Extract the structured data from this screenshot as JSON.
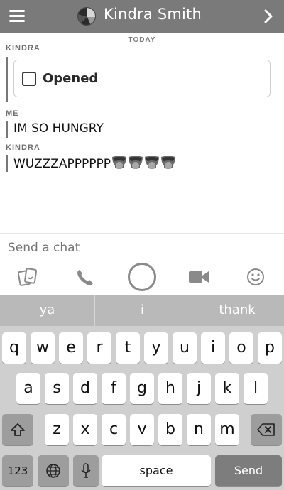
{
  "header": {
    "title": "Kindra Smith"
  },
  "chat": {
    "day_label": "TODAY",
    "messages": [
      {
        "sender": "KINDRA",
        "text": "Opened"
      },
      {
        "sender": "ME",
        "text": "IM SO HUNGRY"
      },
      {
        "sender": "KINDRA",
        "text": "WUZZZAPPPPPP"
      }
    ]
  },
  "compose": {
    "placeholder": "Send a chat"
  },
  "actions": [
    "sticker-icon",
    "phone-icon",
    "capture-button",
    "video-icon",
    "emoji-icon"
  ],
  "keyboard": {
    "suggestions": [
      "ya",
      "i",
      "thank"
    ],
    "row1": [
      "q",
      "w",
      "e",
      "r",
      "t",
      "y",
      "u",
      "i",
      "o",
      "p"
    ],
    "row2": [
      "a",
      "s",
      "d",
      "f",
      "g",
      "h",
      "j",
      "k",
      "l"
    ],
    "row3": [
      "z",
      "x",
      "c",
      "v",
      "b",
      "n",
      "m"
    ],
    "numbers_label": "123",
    "space_label": "space",
    "send_label": "Send"
  },
  "colors": {
    "header": "#7a7a7a",
    "keyboard": "#cfcfcf",
    "send_key": "#7d7d7d"
  }
}
